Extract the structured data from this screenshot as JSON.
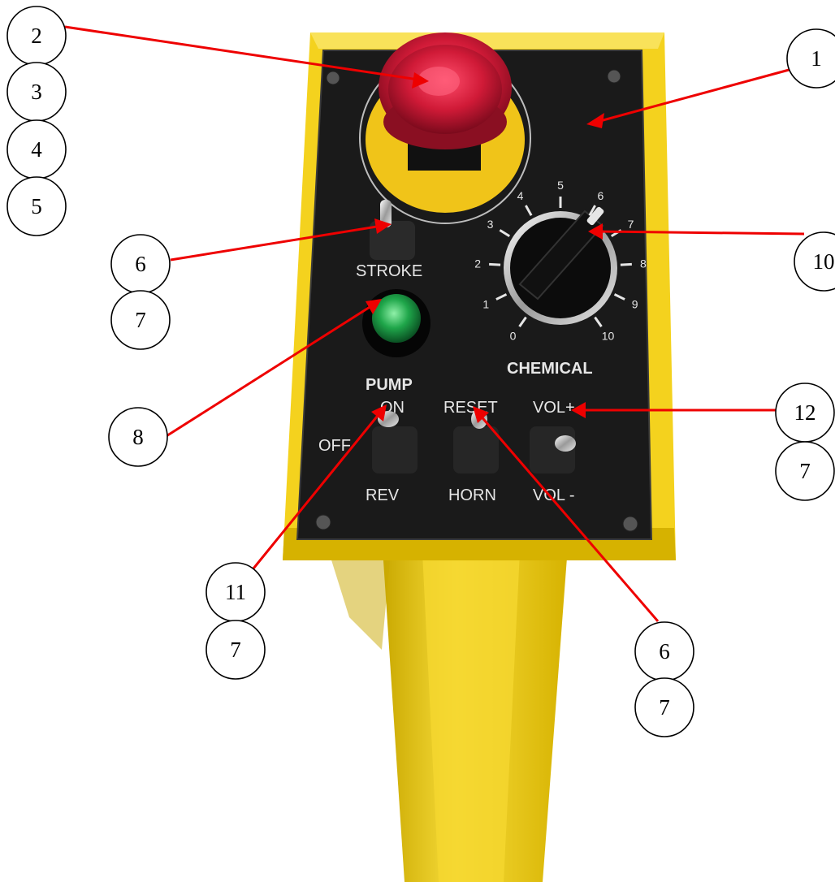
{
  "panel": {
    "labels": {
      "stroke": "STROKE",
      "chemical": "CHEMICAL",
      "pump": "PUMP",
      "on": "ON",
      "off": "OFF",
      "rev": "REV",
      "reset": "RESET",
      "horn": "HORN",
      "vol_plus": "VOL+",
      "vol_minus": "VOL -"
    },
    "dial_scale": [
      "0",
      "1",
      "2",
      "3",
      "4",
      "5",
      "6",
      "7",
      "8",
      "9",
      "10"
    ]
  },
  "callouts": [
    {
      "id": "c1",
      "number": "1"
    },
    {
      "id": "c2",
      "number": "2"
    },
    {
      "id": "c3",
      "number": "3"
    },
    {
      "id": "c4",
      "number": "4"
    },
    {
      "id": "c5",
      "number": "5"
    },
    {
      "id": "c6a",
      "number": "6"
    },
    {
      "id": "c7a",
      "number": "7"
    },
    {
      "id": "c8",
      "number": "8"
    },
    {
      "id": "c10",
      "number": "10"
    },
    {
      "id": "c12",
      "number": "12"
    },
    {
      "id": "c7b",
      "number": "7"
    },
    {
      "id": "c11",
      "number": "11"
    },
    {
      "id": "c7c",
      "number": "7"
    },
    {
      "id": "c6b",
      "number": "6"
    },
    {
      "id": "c7d",
      "number": "7"
    }
  ],
  "colors": {
    "housing": "#f4d21e",
    "housing_shadow": "#d6b200",
    "panel": "#1a1a1a",
    "estop_red": "#c8102e",
    "estop_ring": "#f0c419",
    "pump_lamp": "#1fa64a",
    "leader": "#ee0000"
  }
}
